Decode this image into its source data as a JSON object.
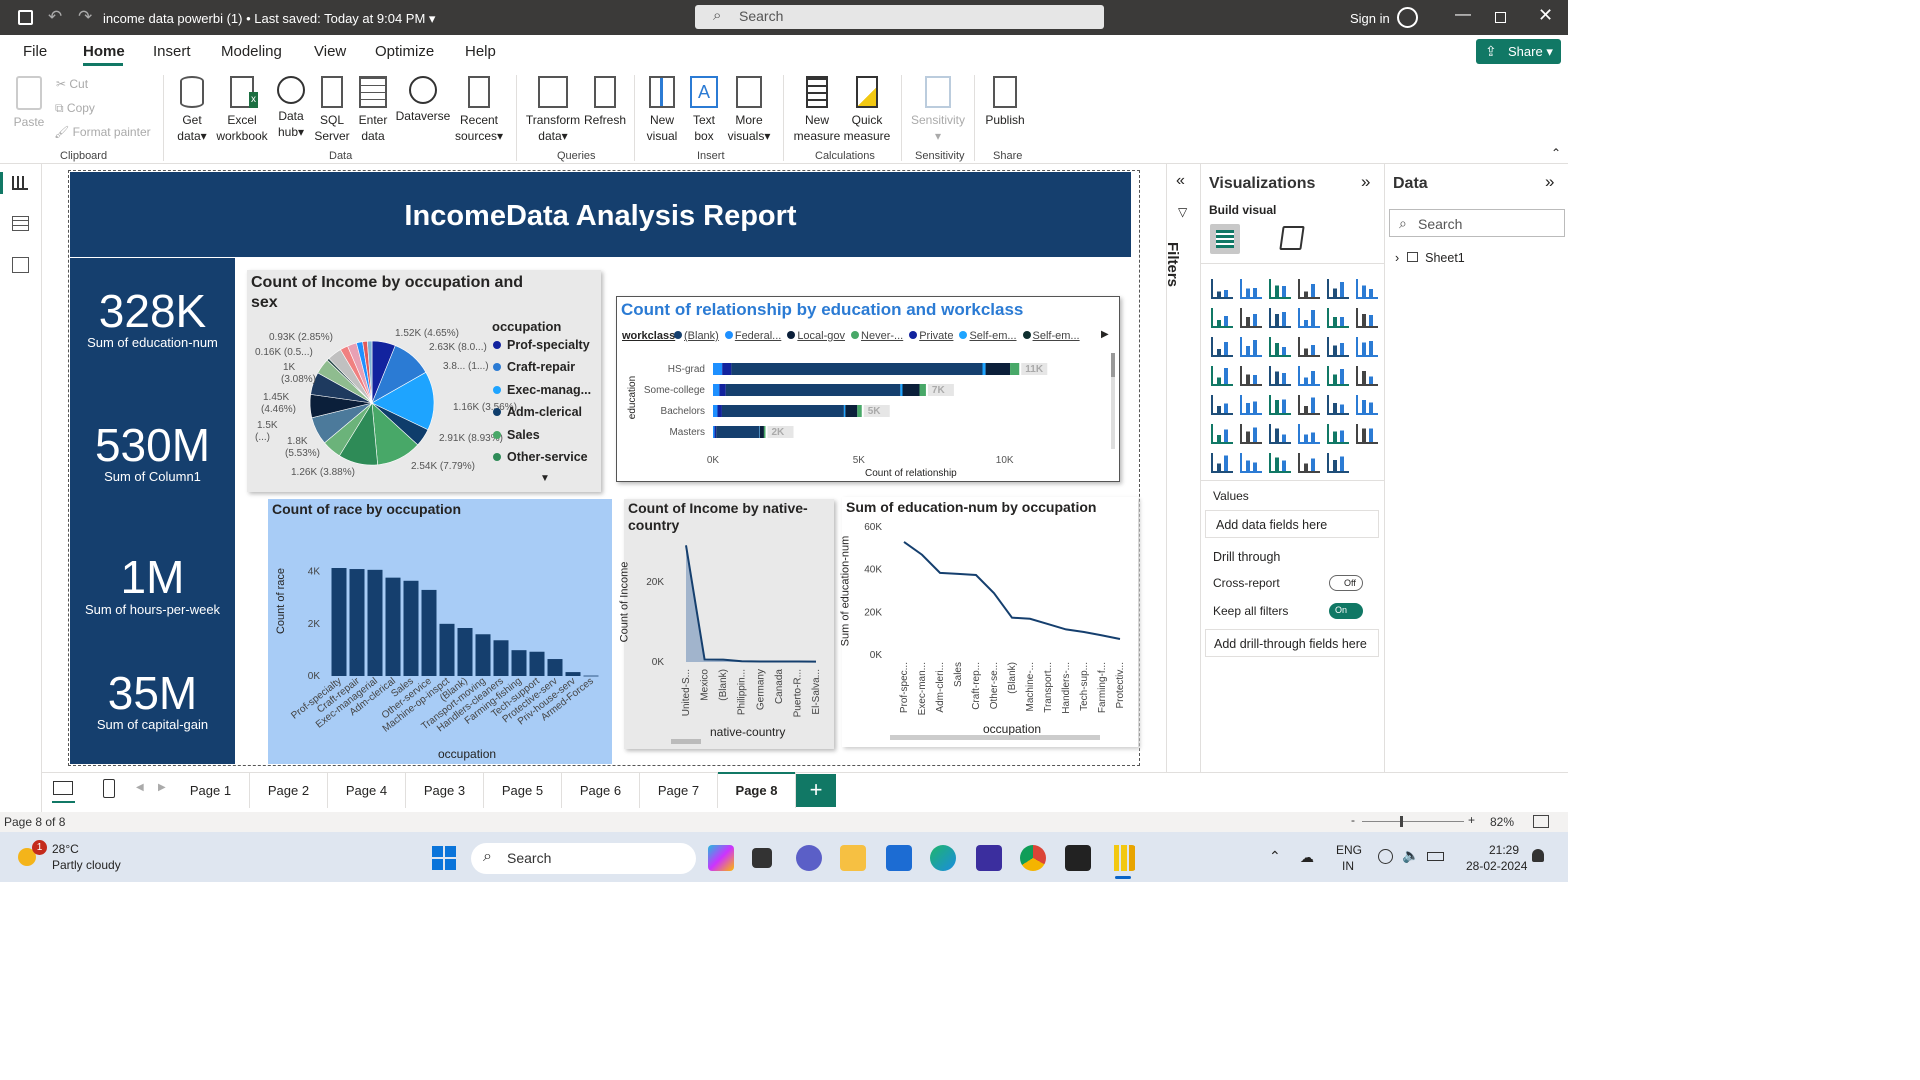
{
  "titlebar": {
    "doc_title": "income data powerbi (1)",
    "saved_status": "Last saved: Today at 9:04 PM",
    "search_placeholder": "Search",
    "sign_in": "Sign in"
  },
  "menu": [
    "File",
    "Home",
    "Insert",
    "Modeling",
    "View",
    "Optimize",
    "Help"
  ],
  "share_label": "Share",
  "ribbon": {
    "clipboard": {
      "paste": "Paste",
      "cut": "Cut",
      "copy": "Copy",
      "format_painter": "Format painter",
      "group": "Clipboard"
    },
    "data": {
      "get_data": "Get",
      "get_data2": "data",
      "excel": "Excel",
      "excel2": "workbook",
      "hub": "Data",
      "hub2": "hub",
      "sql": "SQL",
      "sql2": "Server",
      "enter": "Enter",
      "enter2": "data",
      "dataverse": "Dataverse",
      "recent": "Recent",
      "recent2": "sources",
      "group": "Data"
    },
    "queries": {
      "transform": "Transform",
      "transform2": "data",
      "refresh": "Refresh",
      "group": "Queries"
    },
    "insert": {
      "new_visual": "New",
      "new_visual2": "visual",
      "text_box": "Text",
      "text_box2": "box",
      "more": "More",
      "more2": "visuals",
      "group": "Insert"
    },
    "calculations": {
      "new_measure": "New",
      "new_measure2": "measure",
      "quick": "Quick",
      "quick2": "measure",
      "group": "Calculations"
    },
    "sensitivity": {
      "label": "Sensitivity",
      "group": "Sensitivity"
    },
    "share": {
      "publish": "Publish",
      "group": "Share"
    }
  },
  "report": {
    "title": "IncomeData Analysis Report",
    "kpis": [
      {
        "value": "328K",
        "label": "Sum of education-num"
      },
      {
        "value": "530M",
        "label": "Sum of Column1"
      },
      {
        "value": "1M",
        "label": "Sum of hours-per-week"
      },
      {
        "value": "35M",
        "label": "Sum of capital-gain"
      }
    ]
  },
  "chart_data": [
    {
      "type": "pie",
      "title": "Count of Income by occupation and sex",
      "legend_title": "occupation",
      "legend": [
        "Prof-specialty",
        "Craft-repair",
        "Exec-manag...",
        "Adm-clerical",
        "Sales",
        "Other-service"
      ],
      "slice_labels": [
        "1.52K (4.65%)",
        "2.63K (8.0...)",
        "3.8... (1...)",
        "1.16K (3.56%)",
        "2.91K (8.93%)",
        "2.54K (7.79%)",
        "1.26K (3.88%)",
        "1.8K (5.53%)",
        "1.5K (...)",
        "1.45K (4.46%)",
        "1K (3.08%)",
        "0.16K (0.5...)",
        "0.93K (2.85%)"
      ],
      "values": [
        1.52,
        2.63,
        3.8,
        1.16,
        2.91,
        2.54,
        1.26,
        1.8,
        1.5,
        1.45,
        1.0,
        0.16,
        0.93,
        0.5,
        0.6,
        0.4,
        0.3,
        0.3
      ],
      "colors": [
        "#12239e",
        "#2b7bd4",
        "#1ea4ff",
        "#0f3d6b",
        "#48a868",
        "#2e8b57",
        "#6bb37a",
        "#4c7a9b",
        "#0b1f3a",
        "#1e3a5f",
        "#8fbc8f",
        "#2f4f4f",
        "#c0c0c0",
        "#f08080",
        "#e8a0b4",
        "#1e90ff",
        "#e05a5a",
        "#7fb3d5"
      ]
    },
    {
      "type": "bar",
      "title": "Count of relationship by education and workclass",
      "legend_title": "workclass",
      "legend": [
        "(Blank)",
        "Federal...",
        "Local-gov",
        "Never-...",
        "Private",
        "Self-em...",
        "Self-em..."
      ],
      "legend_colors": [
        "#153f6e",
        "#1e90ff",
        "#0b1f3a",
        "#48a868",
        "#12239e",
        "#1ea4ff",
        "#0f2f2f"
      ],
      "categories": [
        "HS-grad",
        "Some-college",
        "Bachelors",
        "Masters"
      ],
      "totals_labels": [
        "11K",
        "7K",
        "5K",
        "2K"
      ],
      "values": [
        10.5,
        7.3,
        5.1,
        1.8
      ],
      "xticks": [
        "0K",
        "5K",
        "10K"
      ],
      "xmax": 12,
      "xlabel": "Count of relationship",
      "ylabel": "education"
    },
    {
      "type": "bar",
      "title": "Count of race by occupation",
      "categories": [
        "Prof-specialty",
        "Craft-repair",
        "Exec-managerial",
        "Adm-clerical",
        "Sales",
        "Other-service",
        "Machine-op-inspct",
        "(Blank)",
        "Transport-moving",
        "Handlers-cleaners",
        "Farming-fishing",
        "Tech-support",
        "Protective-serv",
        "Priv-house-serv",
        "Armed-Forces"
      ],
      "values": [
        4140,
        4100,
        4070,
        3770,
        3650,
        3300,
        2000,
        1840,
        1600,
        1370,
        990,
        930,
        650,
        150,
        15
      ],
      "yticks": [
        "0K",
        "2K",
        "4K"
      ],
      "ymax": 4600,
      "xlabel": "occupation",
      "ylabel": "Count of race"
    },
    {
      "type": "area",
      "title": "Count of Income by native-country",
      "categories": [
        "United-S...",
        "Mexico",
        "(Blank)",
        "Philippin...",
        "Germany",
        "Canada",
        "Puerto-R...",
        "El-Salva..."
      ],
      "values": [
        29170,
        640,
        580,
        200,
        140,
        120,
        110,
        100
      ],
      "yticks": [
        "0K",
        "20K"
      ],
      "ymax": 32000,
      "xlabel": "native-country",
      "ylabel": "Count of Income"
    },
    {
      "type": "line",
      "title": "Sum of education-num by occupation",
      "categories": [
        "Prof-spec...",
        "Exec-man...",
        "Adm-cleri...",
        "Sales",
        "Craft-rep...",
        "Other-se...",
        "(Blank)",
        "Machine-...",
        "Transport...",
        "Handlers-...",
        "Tech-sup...",
        "Farming-f...",
        "Protectiv..."
      ],
      "values": [
        53000,
        47000,
        38500,
        38000,
        37500,
        29000,
        17500,
        17000,
        14500,
        12000,
        10800,
        9200,
        7500
      ],
      "yticks": [
        "0K",
        "20K",
        "40K",
        "60K"
      ],
      "ymax": 60000,
      "xlabel": "occupation",
      "ylabel": "Sum of education-num"
    }
  ],
  "panes": {
    "filters_label": "Filters",
    "visualizations": "Visualizations",
    "build_visual": "Build visual",
    "values": "Values",
    "add_data": "Add data fields here",
    "drill_through": "Drill through",
    "cross_report": "Cross-report",
    "cross_report_state": "Off",
    "keep_filters": "Keep all filters",
    "keep_filters_state": "On",
    "add_drill": "Add drill-through fields here",
    "data": "Data",
    "data_search": "Search",
    "sheet": "Sheet1"
  },
  "pages": [
    "Page 1",
    "Page 2",
    "Page 4",
    "Page 3",
    "Page 5",
    "Page 6",
    "Page 7",
    "Page 8"
  ],
  "active_page": "Page 8",
  "status": {
    "page_info": "Page 8 of 8",
    "zoom": "82%"
  },
  "taskbar": {
    "temp": "28°C",
    "weather": "Partly cloudy",
    "weather_badge": "1",
    "search": "Search",
    "lang1": "ENG",
    "lang2": "IN",
    "time": "21:29",
    "date": "28-02-2024"
  }
}
